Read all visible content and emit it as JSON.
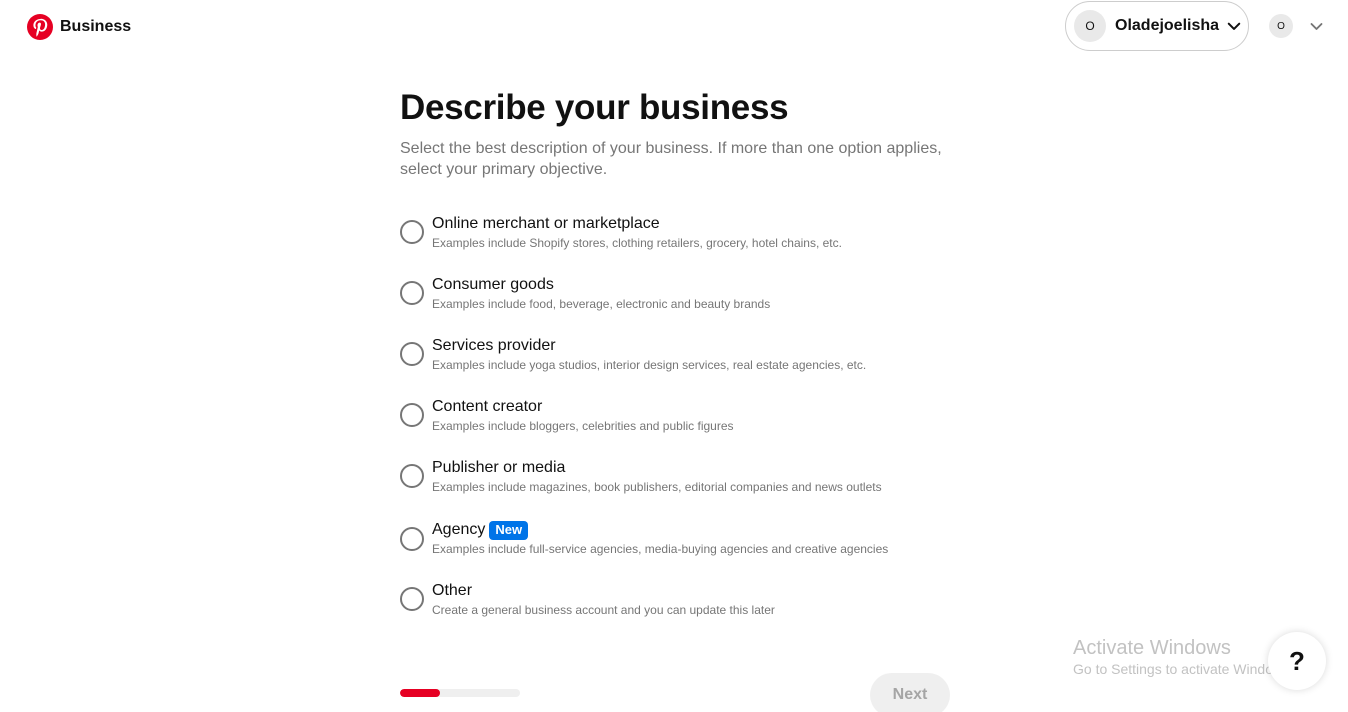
{
  "header": {
    "brand_name": "Business",
    "account": {
      "avatar_initial": "O",
      "name": "Oladejoelisha"
    },
    "secondary_avatar_initial": "O"
  },
  "main": {
    "title": "Describe your business",
    "subtitle": "Select the best description of your business. If more than one option applies, select your primary objective."
  },
  "options": [
    {
      "label": "Online merchant or marketplace",
      "description": "Examples include Shopify stores, clothing retailers, grocery, hotel chains, etc.",
      "selected": false
    },
    {
      "label": "Consumer goods",
      "description": "Examples include food, beverage, electronic and beauty brands",
      "selected": false
    },
    {
      "label": "Services provider",
      "description": "Examples include yoga studios, interior design services, real estate agencies, etc.",
      "selected": false
    },
    {
      "label": "Content creator",
      "description": "Examples include bloggers, celebrities and public figures",
      "selected": false
    },
    {
      "label": "Publisher or media",
      "description": "Examples include magazines, book publishers, editorial companies and news outlets",
      "selected": false
    },
    {
      "label": "Agency",
      "badge": "New",
      "description": "Examples include full-service agencies, media-buying agencies and creative agencies",
      "selected": false
    },
    {
      "label": "Other",
      "description": "Create a general business account and you can update this later",
      "selected": false
    }
  ],
  "progress": {
    "fraction": 0.33
  },
  "footer": {
    "next_label": "Next",
    "next_disabled": true
  },
  "help": {
    "label": "?"
  },
  "watermark": {
    "title": "Activate Windows",
    "subtitle": "Go to Settings to activate Windows."
  },
  "colors": {
    "brand_red": "#e60023",
    "badge_blue": "#0074e8",
    "muted_text": "#767676",
    "disabled_bg": "#efefef"
  }
}
